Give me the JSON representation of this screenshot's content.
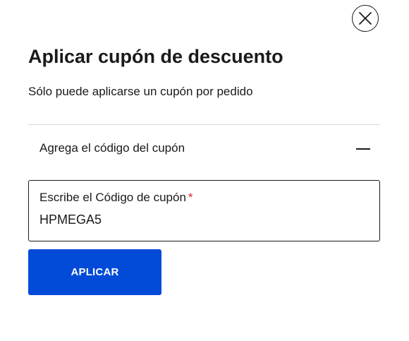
{
  "modal": {
    "title": "Aplicar cupón de descuento",
    "subtitle": "Sólo puede aplicarse un cupón por pedido",
    "close_icon": "close-icon"
  },
  "accordion": {
    "label": "Agrega el código del cupón",
    "toggle_icon": "minus-icon",
    "expanded": true
  },
  "coupon_field": {
    "label": "Escribe el Código de cupón",
    "required_mark": "*",
    "value": "HPMEGA5"
  },
  "apply_button": {
    "label": "APLICAR"
  },
  "colors": {
    "primary": "#024ad8",
    "required": "#e0242b",
    "text": "#1a1a1a",
    "divider": "#d4d4d4"
  }
}
